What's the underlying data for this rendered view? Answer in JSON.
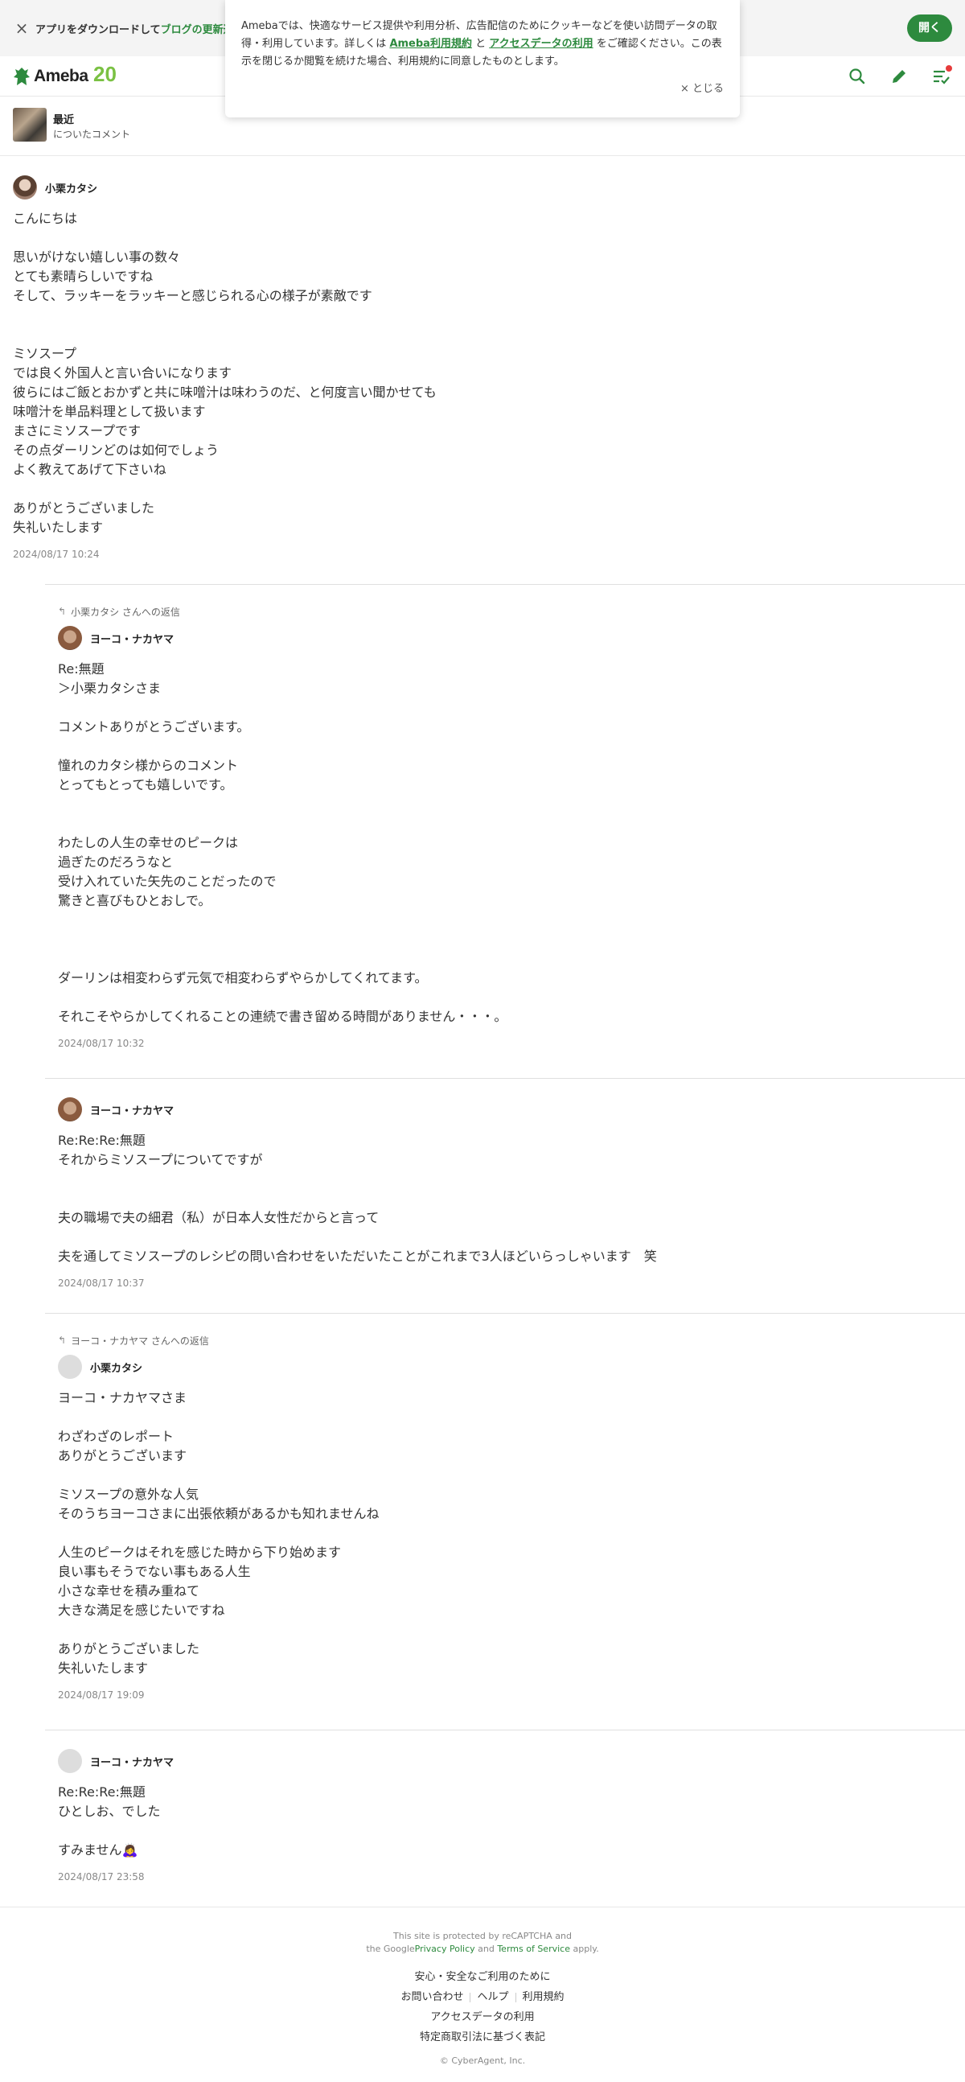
{
  "app_banner": {
    "close": "×",
    "text_prefix": "アプリをダウンロードして",
    "text_highlight": "ブログの更新通知",
    "open_label": "開く"
  },
  "header": {
    "logo": "Ameba",
    "anniversary": "20"
  },
  "cookie_notice": {
    "text_before": "Amebaでは、快適なサービス提供や利用分析、広告配信のためにクッキーなどを使い訪問データの取得・利用しています。詳しくは",
    "link_terms": "Ameba利用規約",
    "and": "と",
    "link_access": "アクセスデータの利用",
    "text_after": "をご確認ください。この表示を閉じるか閲覧を続けた場合、利用規約に同意したものとします。",
    "close_label": "× とじる"
  },
  "entry": {
    "title": "最近",
    "subtitle": "についたコメント"
  },
  "comments": [
    {
      "author": "小栗カタシ",
      "body": "こんにちは\n\n思いがけない嬉しい事の数々\nとても素晴らしいですね\nそして、ラッキーをラッキーと感じられる心の様子が素敵です\n\n\nミソスープ\nでは良く外国人と言い合いになります\n彼らにはご飯とおかずと共に味噌汁は味わうのだ、と何度言い聞かせても\n味噌汁を単品料理として扱います\nまさにミソスープです\nその点ダーリンどのは如何でしょう\nよく教えてあげて下さいね\n\nありがとうございました\n失礼いたします",
      "date": "2024/08/17 10:24"
    },
    {
      "reply_to": "小栗カタシ さんへの返信",
      "author": "ヨーコ・ナカヤマ",
      "body": "Re:無題\n＞小栗カタシさま\n\nコメントありがとうございます。\n\n憧れのカタシ様からのコメント\nとってもとっても嬉しいです。\n\n\nわたしの人生の幸せのピークは\n過ぎたのだろうなと\n受け入れていた矢先のことだったので\n驚きと喜びもひとおしで。\n\n\n\nダーリンは相変わらず元気で相変わらずやらかしてくれてます。\n\nそれこそやらかしてくれることの連続で書き留める時間がありません・・・。",
      "date": "2024/08/17 10:32"
    },
    {
      "author": "ヨーコ・ナカヤマ",
      "body": "Re:Re:Re:無題\nそれからミソスープについてですが\n\n\n夫の職場で夫の細君（私）が日本人女性だからと言って\n\n夫を通してミソスープのレシピの問い合わせをいただいたことがこれまで3人ほどいらっしゃいます　笑",
      "date": "2024/08/17 10:37"
    },
    {
      "reply_to": "ヨーコ・ナカヤマ さんへの返信",
      "author": "小栗カタシ",
      "body": "ヨーコ・ナカヤマさま\n\nわざわざのレポート\nありがとうございます\n\nミソスープの意外な人気\nそのうちヨーコさまに出張依頼があるかも知れませんね\n\n人生のピークはそれを感じた時から下り始めます\n良い事もそうでない事もある人生\n小さな幸せを積み重ねて\n大きな満足を感じたいですね\n\nありがとうございました\n失礼いたします",
      "date": "2024/08/17 19:09"
    },
    {
      "author": "ヨーコ・ナカヤマ",
      "body": "Re:Re:Re:無題\nひとしお、でした\n\nすみません🙇‍♀",
      "date": "2024/08/17 23:58"
    }
  ],
  "footer": {
    "recaptcha_line1": "This site is protected by reCAPTCHA and",
    "recaptcha_the_google": "the Google",
    "privacy": "Privacy Policy",
    "and": "and",
    "terms": "Terms of Service",
    "apply": "apply.",
    "safe_use": "安心・安全なご利用のために",
    "contact": "お問い合わせ",
    "help": "ヘルプ",
    "terms_of_use": "利用規約",
    "access_data": "アクセスデータの利用",
    "tokushoho": "特定商取引法に基づく表記",
    "copyright": "© CyberAgent, Inc."
  }
}
